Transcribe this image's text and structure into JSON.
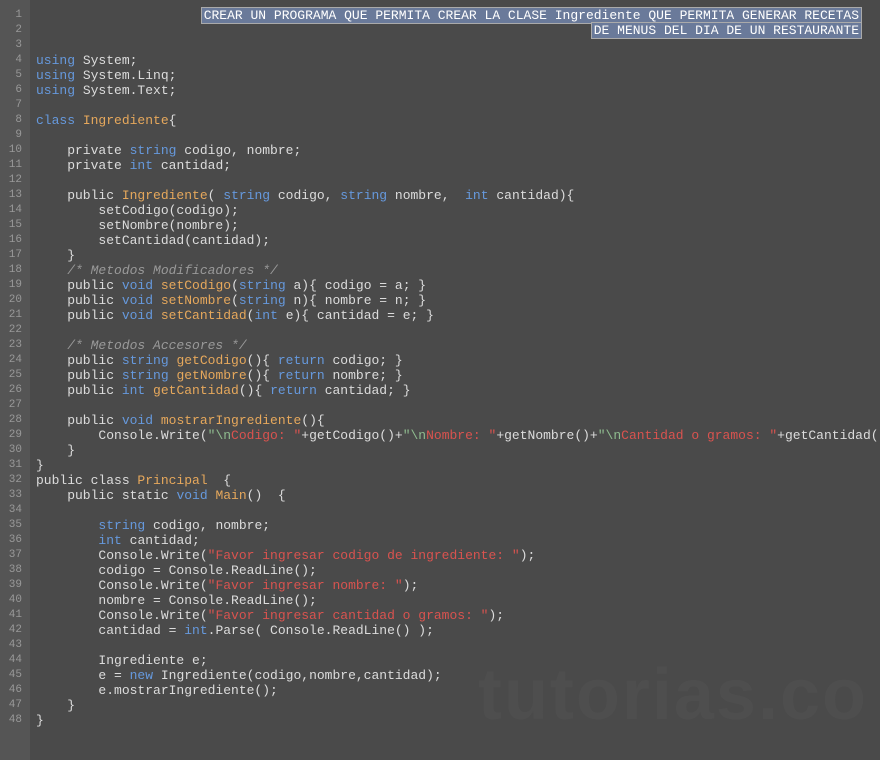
{
  "watermark": "tutorias.co",
  "selection": {
    "line1": "CREAR UN PROGRAMA QUE PERMITA CREAR LA CLASE Ingrediente QUE PERMITA GENERAR RECETAS",
    "line2": "DE MENUS DEL DIA DE UN RESTAURANTE"
  },
  "lines": [
    {
      "num": 1,
      "tokens": []
    },
    {
      "num": 2,
      "tokens": []
    },
    {
      "num": 3,
      "tokens": []
    },
    {
      "num": 4,
      "tokens": [
        {
          "t": "using ",
          "c": "kw-blue"
        },
        {
          "t": "System;",
          "c": "plain"
        }
      ]
    },
    {
      "num": 5,
      "tokens": [
        {
          "t": "using ",
          "c": "kw-blue"
        },
        {
          "t": "System.Linq;",
          "c": "plain"
        }
      ]
    },
    {
      "num": 6,
      "tokens": [
        {
          "t": "using ",
          "c": "kw-blue"
        },
        {
          "t": "System.Text;",
          "c": "plain"
        }
      ]
    },
    {
      "num": 7,
      "tokens": []
    },
    {
      "num": 8,
      "tokens": [
        {
          "t": "class ",
          "c": "kw-blue"
        },
        {
          "t": "Ingrediente",
          "c": "kw-orange"
        },
        {
          "t": "{",
          "c": "plain"
        }
      ]
    },
    {
      "num": 9,
      "tokens": []
    },
    {
      "num": 10,
      "tokens": [
        {
          "t": "    private ",
          "c": "plain"
        },
        {
          "t": "string ",
          "c": "kw-blue"
        },
        {
          "t": "codigo, nombre;",
          "c": "plain"
        }
      ]
    },
    {
      "num": 11,
      "tokens": [
        {
          "t": "    private ",
          "c": "plain"
        },
        {
          "t": "int ",
          "c": "kw-blue"
        },
        {
          "t": "cantidad;",
          "c": "plain"
        }
      ]
    },
    {
      "num": 12,
      "tokens": []
    },
    {
      "num": 13,
      "tokens": [
        {
          "t": "    public ",
          "c": "plain"
        },
        {
          "t": "Ingrediente",
          "c": "kw-orange"
        },
        {
          "t": "( ",
          "c": "plain"
        },
        {
          "t": "string ",
          "c": "kw-blue"
        },
        {
          "t": "codigo, ",
          "c": "plain"
        },
        {
          "t": "string ",
          "c": "kw-blue"
        },
        {
          "t": "nombre,  ",
          "c": "plain"
        },
        {
          "t": "int ",
          "c": "kw-blue"
        },
        {
          "t": "cantidad){",
          "c": "plain"
        }
      ]
    },
    {
      "num": 14,
      "tokens": [
        {
          "t": "        setCodigo(codigo);",
          "c": "plain"
        }
      ]
    },
    {
      "num": 15,
      "tokens": [
        {
          "t": "        setNombre(nombre);",
          "c": "plain"
        }
      ]
    },
    {
      "num": 16,
      "tokens": [
        {
          "t": "        setCantidad(cantidad);",
          "c": "plain"
        }
      ]
    },
    {
      "num": 17,
      "tokens": [
        {
          "t": "    }",
          "c": "plain"
        }
      ]
    },
    {
      "num": 18,
      "tokens": [
        {
          "t": "    /* Metodos Modificadores */",
          "c": "comment"
        }
      ]
    },
    {
      "num": 19,
      "tokens": [
        {
          "t": "    public ",
          "c": "plain"
        },
        {
          "t": "void ",
          "c": "kw-blue"
        },
        {
          "t": "setCodigo",
          "c": "kw-orange"
        },
        {
          "t": "(",
          "c": "plain"
        },
        {
          "t": "string ",
          "c": "kw-blue"
        },
        {
          "t": "a){ codigo = a; }",
          "c": "plain"
        }
      ]
    },
    {
      "num": 20,
      "tokens": [
        {
          "t": "    public ",
          "c": "plain"
        },
        {
          "t": "void ",
          "c": "kw-blue"
        },
        {
          "t": "setNombre",
          "c": "kw-orange"
        },
        {
          "t": "(",
          "c": "plain"
        },
        {
          "t": "string ",
          "c": "kw-blue"
        },
        {
          "t": "n){ nombre = n; }",
          "c": "plain"
        }
      ]
    },
    {
      "num": 21,
      "tokens": [
        {
          "t": "    public ",
          "c": "plain"
        },
        {
          "t": "void ",
          "c": "kw-blue"
        },
        {
          "t": "setCantidad",
          "c": "kw-orange"
        },
        {
          "t": "(",
          "c": "plain"
        },
        {
          "t": "int ",
          "c": "kw-blue"
        },
        {
          "t": "e){ cantidad = e; }",
          "c": "plain"
        }
      ]
    },
    {
      "num": 22,
      "tokens": []
    },
    {
      "num": 23,
      "tokens": [
        {
          "t": "    /* Metodos Accesores */",
          "c": "comment"
        }
      ]
    },
    {
      "num": 24,
      "tokens": [
        {
          "t": "    public ",
          "c": "plain"
        },
        {
          "t": "string ",
          "c": "kw-blue"
        },
        {
          "t": "getCodigo",
          "c": "kw-orange"
        },
        {
          "t": "(){ ",
          "c": "plain"
        },
        {
          "t": "return ",
          "c": "kw-blue"
        },
        {
          "t": "codigo; }",
          "c": "plain"
        }
      ]
    },
    {
      "num": 25,
      "tokens": [
        {
          "t": "    public ",
          "c": "plain"
        },
        {
          "t": "string ",
          "c": "kw-blue"
        },
        {
          "t": "getNombre",
          "c": "kw-orange"
        },
        {
          "t": "(){ ",
          "c": "plain"
        },
        {
          "t": "return ",
          "c": "kw-blue"
        },
        {
          "t": "nombre; }",
          "c": "plain"
        }
      ]
    },
    {
      "num": 26,
      "tokens": [
        {
          "t": "    public ",
          "c": "plain"
        },
        {
          "t": "int ",
          "c": "kw-blue"
        },
        {
          "t": "getCantidad",
          "c": "kw-orange"
        },
        {
          "t": "(){ ",
          "c": "plain"
        },
        {
          "t": "return ",
          "c": "kw-blue"
        },
        {
          "t": "cantidad; }",
          "c": "plain"
        }
      ]
    },
    {
      "num": 27,
      "tokens": []
    },
    {
      "num": 28,
      "tokens": [
        {
          "t": "    public ",
          "c": "plain"
        },
        {
          "t": "void ",
          "c": "kw-blue"
        },
        {
          "t": "mostrarIngrediente",
          "c": "kw-orange"
        },
        {
          "t": "(){",
          "c": "plain"
        }
      ]
    },
    {
      "num": 29,
      "tokens": [
        {
          "t": "        Console.Write(",
          "c": "plain"
        },
        {
          "t": "\"\\n",
          "c": "str-green"
        },
        {
          "t": "Codigo: \"",
          "c": "str-red"
        },
        {
          "t": "+getCodigo()+",
          "c": "plain"
        },
        {
          "t": "\"\\n",
          "c": "str-green"
        },
        {
          "t": "Nombre: \"",
          "c": "str-red"
        },
        {
          "t": "+getNombre()+",
          "c": "plain"
        },
        {
          "t": "\"\\n",
          "c": "str-green"
        },
        {
          "t": "Cantidad o gramos: \"",
          "c": "str-red"
        },
        {
          "t": "+getCantidad());",
          "c": "plain"
        }
      ]
    },
    {
      "num": 30,
      "tokens": [
        {
          "t": "    }",
          "c": "plain"
        }
      ]
    },
    {
      "num": 31,
      "tokens": [
        {
          "t": "}",
          "c": "plain"
        }
      ]
    },
    {
      "num": 32,
      "tokens": [
        {
          "t": "public class ",
          "c": "plain"
        },
        {
          "t": "Principal",
          "c": "kw-orange"
        },
        {
          "t": "  {",
          "c": "plain"
        }
      ]
    },
    {
      "num": 33,
      "tokens": [
        {
          "t": "    public static ",
          "c": "plain"
        },
        {
          "t": "void ",
          "c": "kw-blue"
        },
        {
          "t": "Main",
          "c": "kw-orange"
        },
        {
          "t": "()  {",
          "c": "plain"
        }
      ]
    },
    {
      "num": 34,
      "tokens": []
    },
    {
      "num": 35,
      "tokens": [
        {
          "t": "        ",
          "c": "plain"
        },
        {
          "t": "string ",
          "c": "kw-blue"
        },
        {
          "t": "codigo, nombre;",
          "c": "plain"
        }
      ]
    },
    {
      "num": 36,
      "tokens": [
        {
          "t": "        ",
          "c": "plain"
        },
        {
          "t": "int ",
          "c": "kw-blue"
        },
        {
          "t": "cantidad;",
          "c": "plain"
        }
      ]
    },
    {
      "num": 37,
      "tokens": [
        {
          "t": "        Console.Write(",
          "c": "plain"
        },
        {
          "t": "\"Favor ingresar codigo de ingrediente: \"",
          "c": "str-red"
        },
        {
          "t": ");",
          "c": "plain"
        }
      ]
    },
    {
      "num": 38,
      "tokens": [
        {
          "t": "        codigo = Console.ReadLine();",
          "c": "plain"
        }
      ]
    },
    {
      "num": 39,
      "tokens": [
        {
          "t": "        Console.Write(",
          "c": "plain"
        },
        {
          "t": "\"Favor ingresar nombre: \"",
          "c": "str-red"
        },
        {
          "t": ");",
          "c": "plain"
        }
      ]
    },
    {
      "num": 40,
      "tokens": [
        {
          "t": "        nombre = Console.ReadLine();",
          "c": "plain"
        }
      ]
    },
    {
      "num": 41,
      "tokens": [
        {
          "t": "        Console.Write(",
          "c": "plain"
        },
        {
          "t": "\"Favor ingresar cantidad o gramos: \"",
          "c": "str-red"
        },
        {
          "t": ");",
          "c": "plain"
        }
      ]
    },
    {
      "num": 42,
      "tokens": [
        {
          "t": "        cantidad = ",
          "c": "plain"
        },
        {
          "t": "int",
          "c": "kw-blue"
        },
        {
          "t": ".Parse( Console.ReadLine() );",
          "c": "plain"
        }
      ]
    },
    {
      "num": 43,
      "tokens": []
    },
    {
      "num": 44,
      "tokens": [
        {
          "t": "        Ingrediente e;",
          "c": "plain"
        }
      ]
    },
    {
      "num": 45,
      "tokens": [
        {
          "t": "        e = ",
          "c": "plain"
        },
        {
          "t": "new ",
          "c": "kw-blue"
        },
        {
          "t": "Ingrediente(codigo,nombre,cantidad);",
          "c": "plain"
        }
      ]
    },
    {
      "num": 46,
      "tokens": [
        {
          "t": "        e.mostrarIngrediente();",
          "c": "plain"
        }
      ]
    },
    {
      "num": 47,
      "tokens": [
        {
          "t": "    }",
          "c": "plain"
        }
      ]
    },
    {
      "num": 48,
      "tokens": [
        {
          "t": "}",
          "c": "plain"
        }
      ]
    }
  ]
}
